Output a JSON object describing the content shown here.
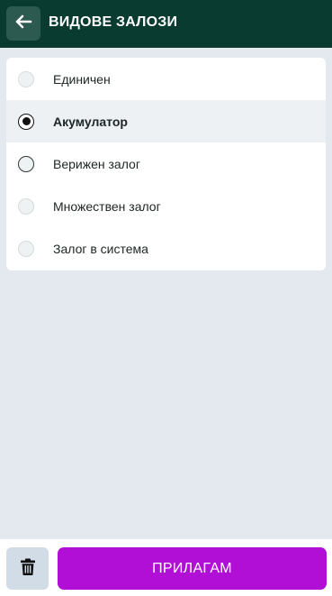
{
  "header": {
    "title": "ВИДОВЕ ЗАЛОЗИ",
    "back_icon": "arrow-left-icon"
  },
  "options": [
    {
      "label": "Единичен",
      "selected": false
    },
    {
      "label": "Акумулатор",
      "selected": true
    },
    {
      "label": "Верижен залог",
      "selected": false
    },
    {
      "label": "Множествен залог",
      "selected": false
    },
    {
      "label": "Залог в система",
      "selected": false
    }
  ],
  "footer": {
    "delete_icon": "trash-icon",
    "apply_label": "ПРИЛАГАМ"
  },
  "colors": {
    "header_bg": "#0a3b31",
    "accent": "#b10fd6",
    "page_bg": "#e4e9ef"
  }
}
